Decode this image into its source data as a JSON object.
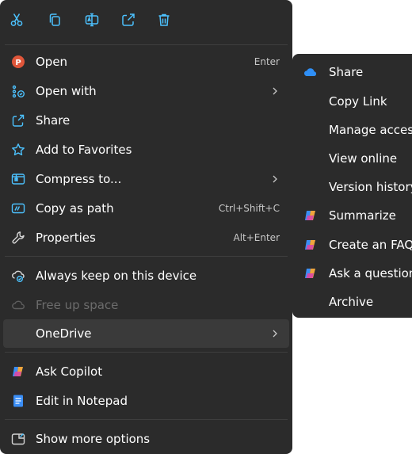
{
  "context_menu": {
    "items": [
      {
        "label": "Open",
        "shortcut": "Enter"
      },
      {
        "label": "Open with"
      },
      {
        "label": "Share"
      },
      {
        "label": "Add to Favorites"
      },
      {
        "label": "Compress to..."
      },
      {
        "label": "Copy as path",
        "shortcut": "Ctrl+Shift+C"
      },
      {
        "label": "Properties",
        "shortcut": "Alt+Enter"
      },
      {
        "label": "Always keep on this device"
      },
      {
        "label": "Free up space"
      },
      {
        "label": "OneDrive"
      },
      {
        "label": "Ask Copilot"
      },
      {
        "label": "Edit in Notepad"
      },
      {
        "label": "Show more options"
      }
    ]
  },
  "onedrive_submenu": {
    "items": [
      {
        "label": "Share"
      },
      {
        "label": "Copy Link"
      },
      {
        "label": "Manage access"
      },
      {
        "label": "View online"
      },
      {
        "label": "Version history"
      },
      {
        "label": "Summarize"
      },
      {
        "label": "Create an FAQ"
      },
      {
        "label": "Ask a question"
      },
      {
        "label": "Archive"
      }
    ]
  },
  "colors": {
    "menu_background": "#2b2b2b",
    "hover_background": "#3a3a3a",
    "accent_blue": "#4cc2ff",
    "disabled_text": "#6c6c6c"
  }
}
